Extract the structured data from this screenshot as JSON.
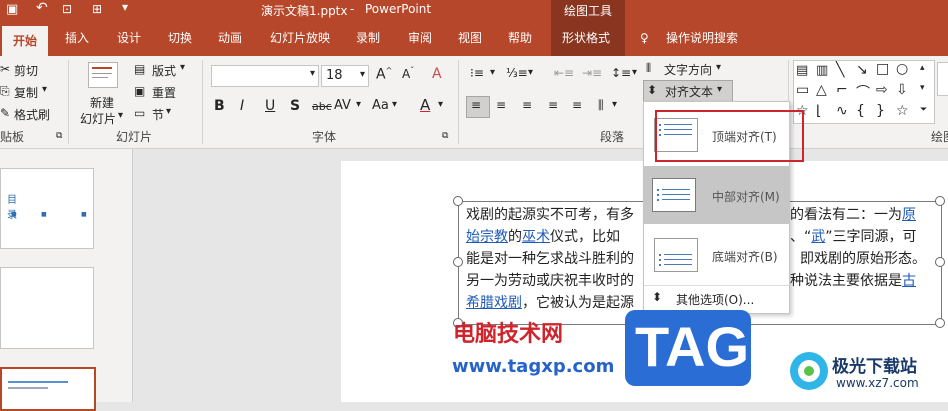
{
  "titlebar": {
    "filename": "演示文稿1.pptx",
    "separator": "-",
    "app": "PowerPoint",
    "context_title": "绘图工具"
  },
  "tabs": [
    "开始",
    "插入",
    "设计",
    "切换",
    "动画",
    "幻灯片放映",
    "录制",
    "审阅",
    "视图",
    "帮助",
    "形状格式"
  ],
  "tell_me": "操作说明搜索",
  "ribbon": {
    "clipboard": {
      "cut": "剪切",
      "copy": "复制",
      "format_painter": "格式刷",
      "label": "贴板"
    },
    "slides": {
      "new_slide_line1": "新建",
      "new_slide_line2": "幻灯片",
      "layout": "版式",
      "reset": "重置",
      "section": "节",
      "label": "幻灯片"
    },
    "font": {
      "font_name": "",
      "font_size": "18",
      "label": "字体",
      "bold": "B",
      "italic": "I",
      "underline": "U",
      "strike": "S",
      "shadow": "abc",
      "spacing": "AV",
      "case": "Aa",
      "color": "A"
    },
    "paragraph": {
      "label": "段落",
      "text_direction": "文字方向",
      "align_text": "对齐文本"
    },
    "drawing": {
      "label": "绘图"
    }
  },
  "dropdown": {
    "items": [
      {
        "label": "顶端对齐(T)"
      },
      {
        "label": "中部对齐(M)"
      },
      {
        "label": "底端对齐(B)"
      }
    ],
    "more": "其他选项(O)..."
  },
  "thumbs": {
    "title_chars": "目 录"
  },
  "slide_text": {
    "line1a": "戏剧的起源实不可考，有多",
    "line1b": "的看法有二：一为",
    "line1link": "原",
    "line2link1": "始宗教",
    "line2a": "的",
    "line2link2": "巫术",
    "line2b": "仪式，比如",
    "line2c": "、“",
    "line2link3": "武",
    "line2d": "”三字同源，可",
    "line3a": "能是对一种乞求战斗胜利的",
    "line3b": "即戏剧的原始形态。",
    "line4a": "另一为劳动或庆祝丰收时的",
    "line4b": "种说法主要依据是",
    "line4link": "古",
    "line5link": "希腊戏剧",
    "line5a": "，它被认为是起源"
  },
  "watermarks": {
    "site_cn": "电脑技术网",
    "site_url": "www.tagxp.com",
    "tag": "TAG",
    "xz_cn": "极光下载站",
    "xz_url": "www.xz7.com"
  },
  "colors": {
    "accent": "#b7472a",
    "context": "#8a3520",
    "highlight": "#d0242c"
  }
}
